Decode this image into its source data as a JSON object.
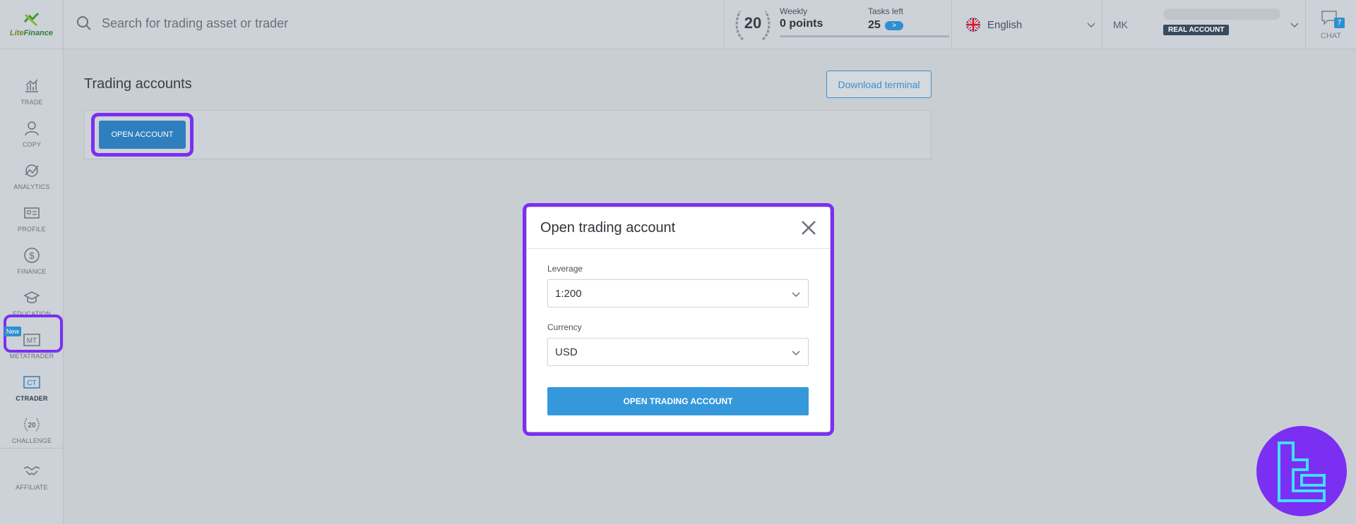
{
  "brand": {
    "logo_text_a": "Lite",
    "logo_text_b": "Finance"
  },
  "search": {
    "placeholder": "Search for trading asset or trader"
  },
  "challenge": {
    "level": "20",
    "weekly_label": "Weekly",
    "weekly_points": "0 points",
    "tasks_label": "Tasks left",
    "tasks_count": "25",
    "tasks_arrow": ">"
  },
  "language": {
    "label": "English"
  },
  "user": {
    "initials": "MK",
    "account_type": "REAL ACCOUNT"
  },
  "chat": {
    "label": "CHAT",
    "badge": "7"
  },
  "sidebar": {
    "items": [
      {
        "label": "TRADE",
        "icon": "chart-icon"
      },
      {
        "label": "COPY",
        "icon": "person-icon"
      },
      {
        "label": "ANALYTICS",
        "icon": "analytics-icon"
      },
      {
        "label": "PROFILE",
        "icon": "id-card-icon"
      },
      {
        "label": "FINANCE",
        "icon": "dollar-icon"
      },
      {
        "label": "EDUCATION",
        "icon": "graduation-cap-icon"
      },
      {
        "label": "METATRADER",
        "icon": "mt-icon"
      },
      {
        "label": "CTRADER",
        "icon": "ct-icon"
      },
      {
        "label": "CHALLENGE",
        "icon": "laurel-icon"
      },
      {
        "label": "AFFILIATE",
        "icon": "handshake-icon"
      }
    ],
    "mt_glyph": "MT",
    "ct_glyph": "CT",
    "challenge_glyph": "20",
    "new_tag": "New"
  },
  "main": {
    "title": "Trading accounts",
    "download_label": "Download terminal",
    "open_account_label": "OPEN ACCOUNT"
  },
  "modal": {
    "title": "Open trading account",
    "leverage_label": "Leverage",
    "leverage_value": "1:200",
    "currency_label": "Currency",
    "currency_value": "USD",
    "submit_label": "OPEN TRADING ACCOUNT"
  },
  "colors": {
    "highlight": "#7b2ff2",
    "accent": "#3598db",
    "background": "#c9ced3"
  }
}
